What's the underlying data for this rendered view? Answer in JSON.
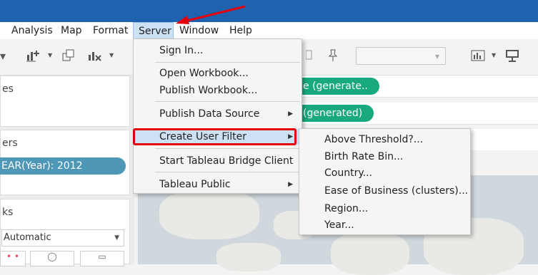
{
  "menubar": {
    "items": [
      {
        "label": "Analysis",
        "name": "menu-analysis"
      },
      {
        "label": "Map",
        "name": "menu-map"
      },
      {
        "label": "Format",
        "name": "menu-format"
      },
      {
        "label": "Server",
        "name": "menu-server"
      },
      {
        "label": "Window",
        "name": "menu-window"
      },
      {
        "label": "Help",
        "name": "menu-help"
      }
    ],
    "active": "Server"
  },
  "left_pane": {
    "cards": [
      {
        "title": "es"
      },
      {
        "title": "ers"
      },
      {
        "title": "ks"
      }
    ],
    "filter_pill": "EAR(Year): 2012",
    "marks_type": "Automatic"
  },
  "shelves": {
    "pill_1": "e (generate..",
    "pill_2": "(generated)"
  },
  "server_menu": {
    "items": [
      "Sign In...",
      "Open Workbook...",
      "Publish Workbook...",
      "Publish Data Source",
      "Create User Filter",
      "Start Tableau Bridge Client",
      "Tableau Public"
    ]
  },
  "user_filter_submenu": {
    "items": [
      "Above Threshold?...",
      "Birth Rate Bin...",
      "Country...",
      "Ease of Business (clusters)...",
      "Region...",
      "Year..."
    ]
  },
  "colors": {
    "titlebar": "#1f62b0",
    "highlight": "#cde1f4",
    "annotation_red": "#e3000b",
    "filter_pill": "#4e97b7",
    "green_pill": "#19a97e"
  }
}
